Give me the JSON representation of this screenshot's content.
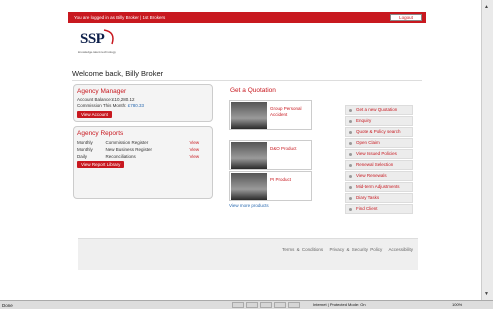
{
  "topbar": {
    "user_text": "You are logged in as Billy Broker | 1st Brokers",
    "logout_label": "Logout"
  },
  "logo": {
    "brand": "SSP",
    "tagline": "knowledge.talent.technology"
  },
  "welcome": "Welcome back, Billy Broker",
  "agency_manager": {
    "title": "Agency Manager",
    "balance": "Account Balance:£10,280.12",
    "commission_label": "Commission This Month: ",
    "commission_value": "£780.33",
    "button": "View Account"
  },
  "agency_reports": {
    "title": "Agency Reports",
    "rows": [
      {
        "period": "Monthly",
        "name": "Commission Register",
        "action": "View"
      },
      {
        "period": "Monthly",
        "name": "New Business Register",
        "action": "View"
      },
      {
        "period": "Daily",
        "name": "Reconciliations",
        "action": "View"
      }
    ],
    "button": "View Report Library"
  },
  "quotation": {
    "title": "Get a Quotation",
    "products": [
      {
        "label": "Group Personal Accident"
      },
      {
        "label": "D&O Product"
      },
      {
        "label": "PI Product"
      }
    ],
    "view_more": "View more products"
  },
  "actions": [
    "Get a new Quotation",
    "Enquiry",
    "Quote & Policy search",
    "Open Claim",
    "View Issued Policies",
    "Renewal Selection",
    "View Renewals",
    "Mid-term Adjustments",
    "Diary Tasks",
    "Find Client"
  ],
  "footer": {
    "terms": "Terms & Conditions",
    "privacy": "Privacy & Security Policy",
    "accessibility": "Accessibility"
  },
  "statusbar": {
    "status": "Done",
    "zone": "Internet | Protected Mode: On",
    "zoom": "100%"
  },
  "colors": {
    "brand_red": "#c8181f",
    "link_blue": "#2a6ab0"
  }
}
